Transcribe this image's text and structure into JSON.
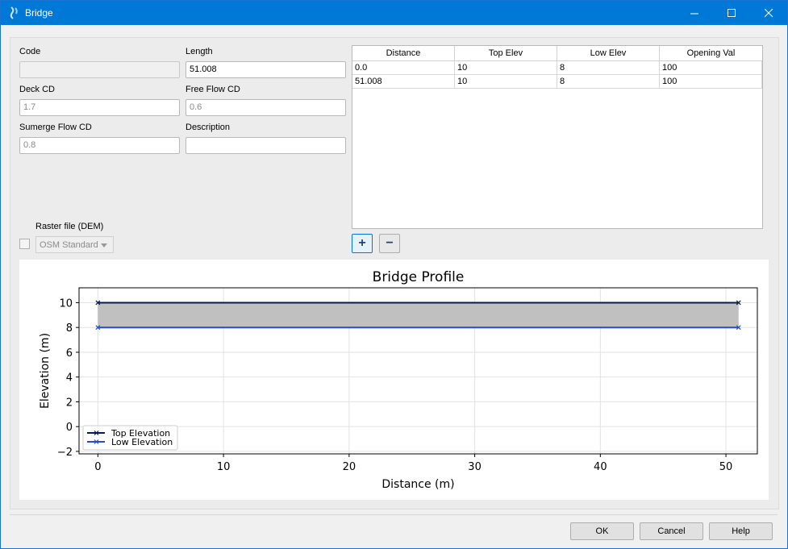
{
  "window": {
    "title": "Bridge",
    "icon": "app-logo-icon",
    "accent": "#0078d7"
  },
  "titlebar": {
    "controls": [
      "minimize-icon",
      "maximize-icon",
      "close-icon"
    ]
  },
  "form": {
    "code_label": "Code",
    "code_value": "",
    "length_label": "Length",
    "length_value": "51.008",
    "deck_cd_label": "Deck CD",
    "deck_cd_placeholder": "1.7",
    "free_flow_cd_label": "Free Flow CD",
    "free_flow_cd_placeholder": "0.6",
    "sumerge_flow_cd_label": "Sumerge Flow CD",
    "sumerge_flow_cd_placeholder": "0.8",
    "description_label": "Description",
    "description_value": ""
  },
  "table": {
    "headers": [
      "Distance",
      "Top Elev",
      "Low Elev",
      "Opening Val"
    ],
    "rows": [
      [
        "0.0",
        "10",
        "8",
        "100"
      ],
      [
        "51.008",
        "10",
        "8",
        "100"
      ]
    ],
    "add_label": "+",
    "remove_label": "−"
  },
  "raster": {
    "label": "Raster file (DEM)",
    "checked": false,
    "selected": "OSM Standard"
  },
  "chart_data": {
    "type": "line",
    "title": "Bridge Profile",
    "xlabel": "Distance (m)",
    "ylabel": "Elevation (m)",
    "xlim": [
      -1.5,
      52.5
    ],
    "ylim": [
      -2.2,
      11.2
    ],
    "xticks": [
      0,
      10,
      20,
      30,
      40,
      50
    ],
    "yticks": [
      -2,
      0,
      2,
      4,
      6,
      8,
      10
    ],
    "grid": true,
    "legend_position": "lower-left",
    "fill_between": {
      "color": "#c0c0c0"
    },
    "series": [
      {
        "name": "Top Elevation",
        "x": [
          0,
          51.008
        ],
        "y": [
          10,
          10
        ],
        "color": "#0a1a4a",
        "marker": "x"
      },
      {
        "name": "Low Elevation",
        "x": [
          0,
          51.008
        ],
        "y": [
          8,
          8
        ],
        "color": "#1f4fd6",
        "marker": "x"
      }
    ]
  },
  "footer": {
    "ok_label": "OK",
    "cancel_label": "Cancel",
    "help_label": "Help"
  }
}
